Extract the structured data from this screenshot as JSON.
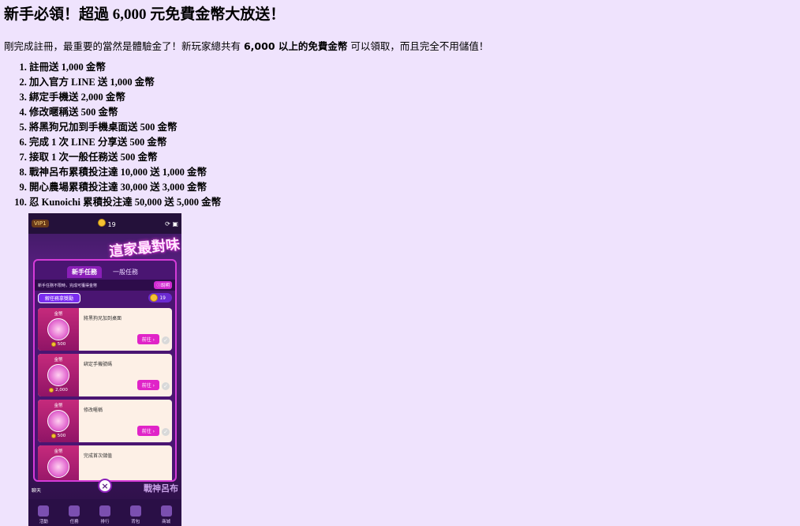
{
  "heading": "新手必領！超過 6,000 元免費金幣大放送！",
  "intro": {
    "before": "剛完成註冊，最重要的當然是體驗金了！新玩家總共有 ",
    "bold": "6,000 以上的免費金幣",
    "after": " 可以領取，而且完全不用儲值！"
  },
  "list": [
    "註冊送 1,000 金幣",
    "加入官方 LINE 送 1,000 金幣",
    "綁定手機送 2,000 金幣",
    "修改暱稱送 500 金幣",
    "將黑狗兄加到手機桌面送 500 金幣",
    "完成 1 次 LINE 分享送 500 金幣",
    "接取 1 次一般任務送 500 金幣",
    "戰神呂布累積投注達 10,000 送 1,000 金幣",
    "開心農場累積投注達 30,000 送 3,000 金幣",
    "忍 Kunoichi 累積投注達 50,000 送 5,000 金幣"
  ],
  "phone": {
    "vip": "VIP1",
    "coins": "19",
    "banner": "這家最對味",
    "tabs": [
      "新手任務",
      "一般任務"
    ],
    "note": "新手任務不限時，完成可獲得金幣",
    "help": "說明",
    "reward_button": "解任務拿獎勵",
    "count": "19",
    "cards": [
      {
        "label": "金幣",
        "amount": "500",
        "title": "將黑狗兄加到桌面",
        "go": "前往 ›"
      },
      {
        "label": "金幣",
        "amount": "2,000",
        "title": "綁定手機號碼",
        "go": "前往 ›"
      },
      {
        "label": "金幣",
        "amount": "500",
        "title": "修改暱稱",
        "go": "前往 ›"
      },
      {
        "label": "金幣",
        "amount": "",
        "title": "完成首次儲值",
        "go": ""
      }
    ],
    "chat": "聊天",
    "side": "戰神呂布",
    "nav": [
      "活動",
      "任務",
      "排行",
      "背包",
      "商城"
    ]
  },
  "colors": {
    "background": "#efe3fd",
    "accent": "#d53bd8"
  }
}
